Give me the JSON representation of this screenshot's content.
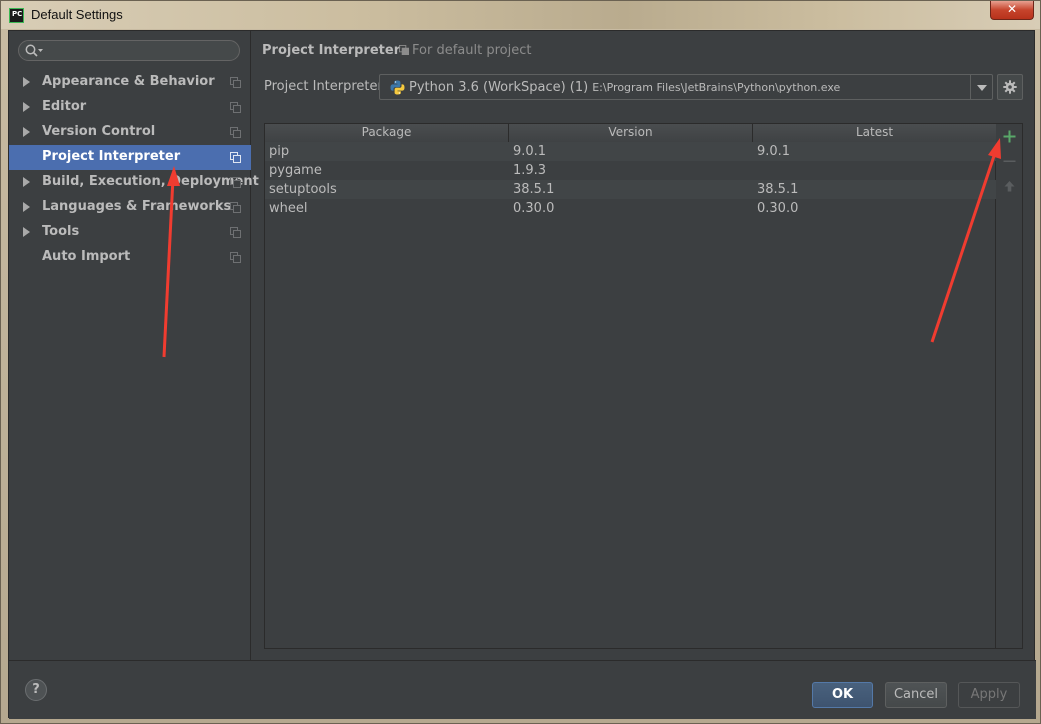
{
  "window": {
    "title": "Default Settings",
    "app_icon_text": "PC",
    "close_glyph": "✕"
  },
  "sidebar": {
    "search": {
      "value": "",
      "placeholder": ""
    },
    "items": [
      {
        "label": "Appearance & Behavior",
        "expandable": true
      },
      {
        "label": "Editor",
        "expandable": true
      },
      {
        "label": "Version Control",
        "expandable": true
      },
      {
        "label": "Project Interpreter",
        "expandable": false,
        "selected": true
      },
      {
        "label": "Build, Execution, Deployment",
        "expandable": true
      },
      {
        "label": "Languages & Frameworks",
        "expandable": true
      },
      {
        "label": "Tools",
        "expandable": true
      },
      {
        "label": "Auto Import",
        "expandable": false
      }
    ]
  },
  "header": {
    "title": "Project Interpreter",
    "note": "For default project"
  },
  "interpreter": {
    "label": "Project Interpreter:",
    "name": "Python 3.6 (WorkSpace) (1)",
    "path": "E:\\Program Files\\JetBrains\\Python\\python.exe"
  },
  "packages": {
    "columns": [
      "Package",
      "Version",
      "Latest"
    ],
    "rows": [
      {
        "package": "pip",
        "version": "9.0.1",
        "latest": "9.0.1"
      },
      {
        "package": "pygame",
        "version": "1.9.3",
        "latest": ""
      },
      {
        "package": "setuptools",
        "version": "38.5.1",
        "latest": "38.5.1"
      },
      {
        "package": "wheel",
        "version": "0.30.0",
        "latest": "0.30.0"
      }
    ]
  },
  "footer": {
    "help_label": "?",
    "ok_label": "OK",
    "cancel_label": "Cancel",
    "apply_label": "Apply"
  },
  "colors": {
    "background": "#3c3f41",
    "selection": "#4b6eaf",
    "add_icon": "#59a869",
    "annotation_arrow": "#f03c30"
  },
  "icons": {
    "search": "search-icon",
    "copy": "copy-icon",
    "python": "python-icon",
    "gear": "gear-icon",
    "add": "plus-icon",
    "remove": "minus-icon",
    "upgrade": "arrow-up-icon"
  }
}
